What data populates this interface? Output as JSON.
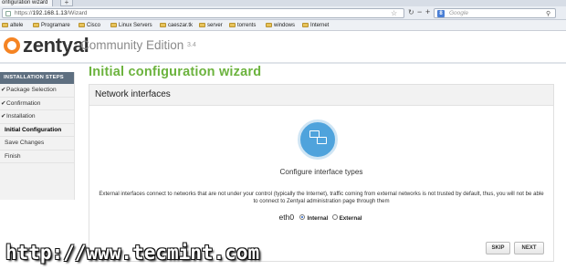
{
  "browser": {
    "tab_title": "onfiguration wizard",
    "new_tab": "+",
    "url_proto": "https://",
    "url_host": "192.168.1.13",
    "url_path": "/Wizard",
    "search_placeholder": "Google",
    "search_engine_letter": "8",
    "bookmarks": [
      "altele",
      "Programare",
      "Cisco",
      "Linux Servers",
      "caeszar.tk",
      "server",
      "torrents",
      "windows",
      "Internet"
    ]
  },
  "app": {
    "brand": "zentyal",
    "edition": "Community Edition",
    "version": "3.4"
  },
  "sidebar": {
    "title": "INSTALLATION STEPS",
    "steps": [
      {
        "label": "Package Selection",
        "done": true
      },
      {
        "label": "Confirmation",
        "done": true
      },
      {
        "label": "Installation",
        "done": true
      },
      {
        "label": "Initial Configuration",
        "current": true
      },
      {
        "label": "Save Changes"
      },
      {
        "label": "Finish"
      }
    ]
  },
  "main": {
    "title": "Initial configuration wizard",
    "panel_title": "Network interfaces",
    "caption": "Configure interface types",
    "description": "External interfaces connect to networks that are not under your control (typically the Internet), traffic coming from external networks is not trusted by default, thus, you will not be able to connect to Zentyal administration page through them",
    "interface": {
      "name": "eth0",
      "options": [
        "Internal",
        "External"
      ],
      "selected": "Internal"
    },
    "buttons": {
      "skip": "SKIP",
      "next": "NEXT"
    }
  },
  "watermark": "http://www.tecmint.com",
  "colors": {
    "accent_green": "#6cb33e",
    "logo_orange": "#f58423",
    "icon_blue": "#4fa3dc",
    "sidebar_header": "#5e6f80"
  }
}
